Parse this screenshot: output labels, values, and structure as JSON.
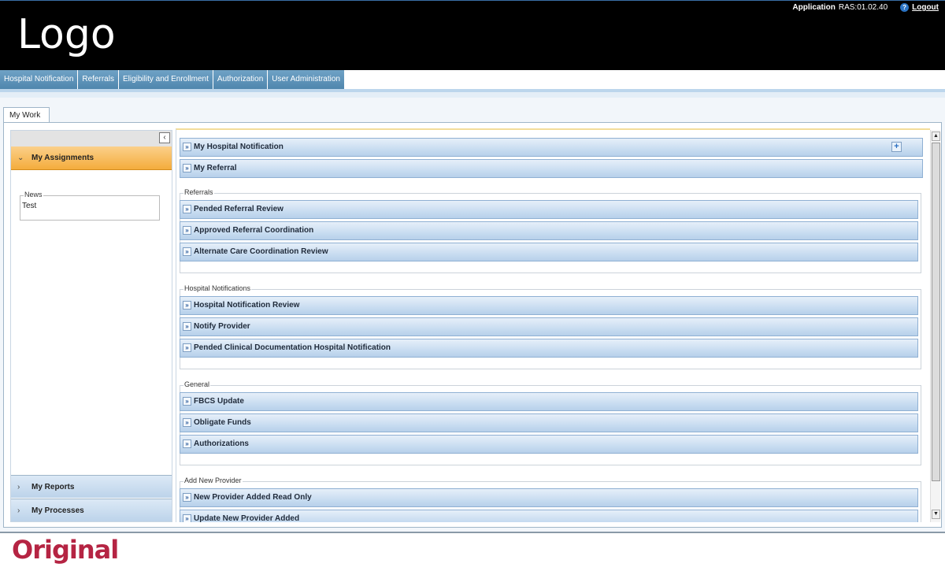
{
  "header": {
    "logo": "Logo",
    "app_label": "Application",
    "version": "RAS:01.02.40",
    "help_icon": "question-circle-icon",
    "logout": "Logout"
  },
  "main_nav": {
    "tabs": [
      "Hospital Notification",
      "Referrals",
      "Eligibility and Enrollment",
      "Authorization",
      "User Administration"
    ]
  },
  "work_tab": "My Work",
  "left_panel": {
    "active_section": "My Assignments",
    "news": {
      "legend": "News",
      "text": "Test"
    },
    "sections": [
      "My Reports",
      "My Processes"
    ]
  },
  "right_panel": {
    "top_items": [
      "My Hospital Notification",
      "My Referral"
    ],
    "groups": [
      {
        "legend": "Referrals",
        "items": [
          "Pended Referral Review",
          "Approved Referral Coordination",
          "Alternate Care Coordination Review"
        ]
      },
      {
        "legend": "Hospital Notifications",
        "items": [
          "Hospital Notification Review",
          "Notify Provider",
          "Pended Clinical Documentation Hospital Notification"
        ]
      },
      {
        "legend": "General",
        "items": [
          "FBCS Update",
          "Obligate Funds",
          "Authorizations"
        ]
      },
      {
        "legend": "Add New Provider",
        "items": [
          "New Provider Added Read Only",
          "Update New Provider Added"
        ]
      }
    ]
  },
  "caption": "Original",
  "colors": {
    "header_bg": "#000000",
    "nav_tab": "#5b8fb7",
    "active_accordion": "#f4ac3c",
    "bar_border": "#8fb0d3",
    "caption": "#b52443"
  }
}
